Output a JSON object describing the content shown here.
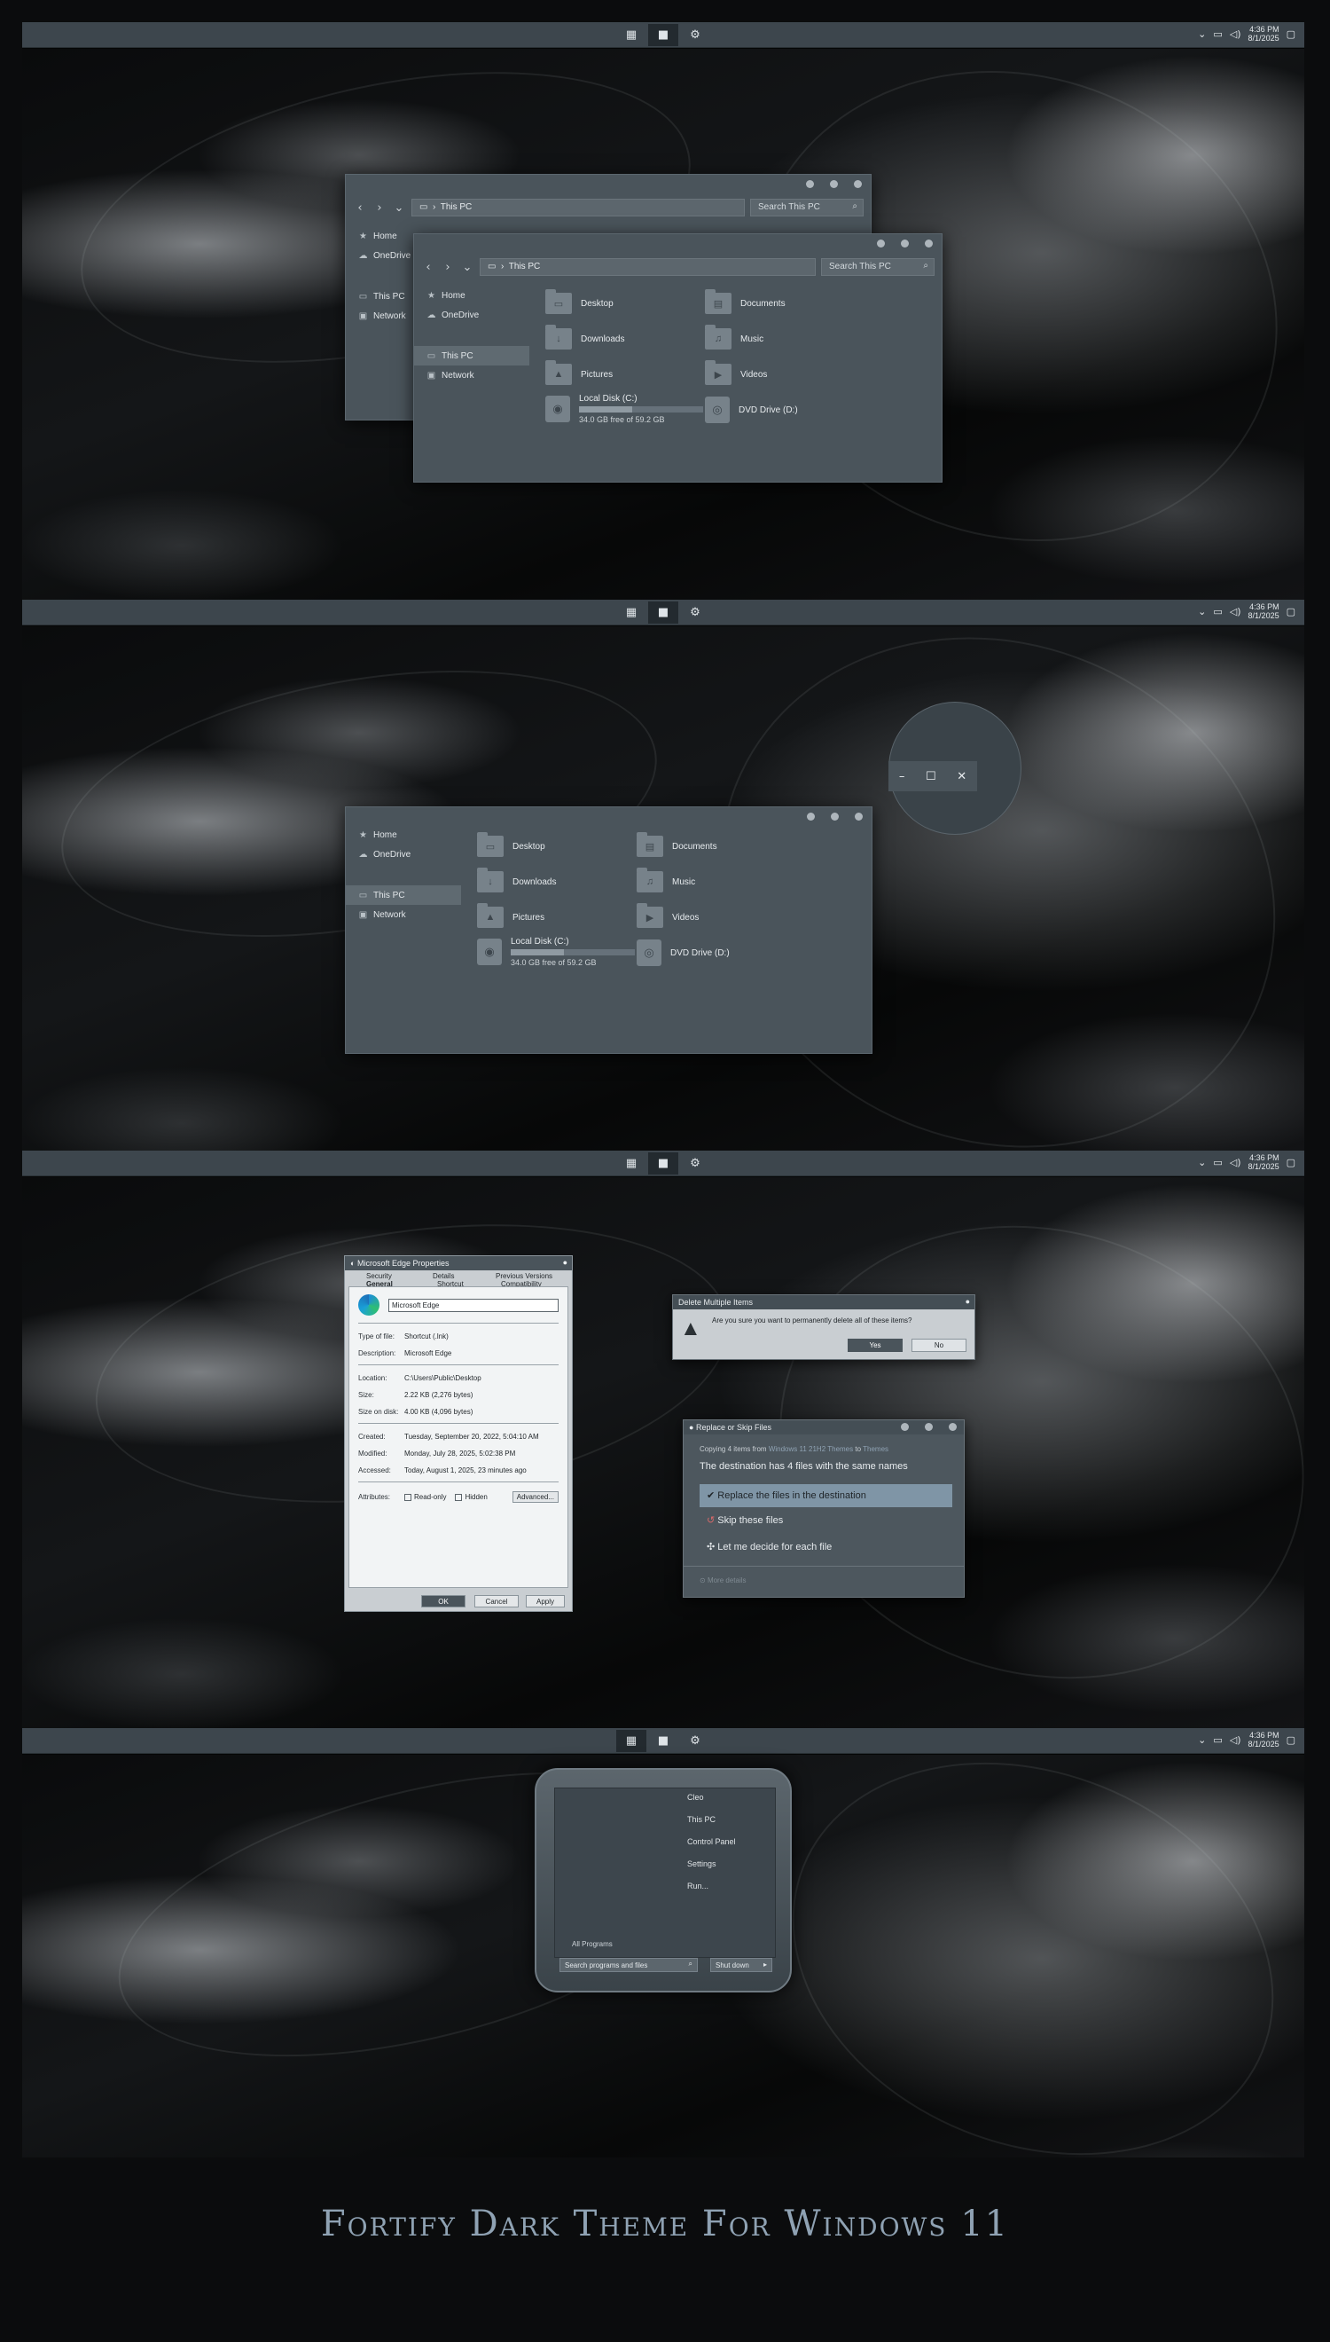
{
  "colors": {
    "taskbar": "#3d464d",
    "window": "#4a545b",
    "accent": "#8fa2b3",
    "selection": "#7f95a6"
  },
  "taskbar": {
    "time": "4:36 PM",
    "date": "8/1/2025",
    "icons": [
      "start-grid-icon",
      "file-explorer-icon",
      "settings-icon"
    ]
  },
  "explorer": {
    "address": "This PC",
    "search_placeholder": "Search This PC",
    "nav": [
      "Home",
      "OneDrive",
      "This PC",
      "Network"
    ],
    "folders": [
      "Desktop",
      "Documents",
      "Downloads",
      "Music",
      "Pictures",
      "Videos"
    ],
    "drive_c": {
      "label": "Local Disk (C:)",
      "space": "34.0 GB free of 59.2 GB",
      "used_fraction": 0.43
    },
    "drive_d": {
      "label": "DVD Drive (D:)"
    }
  },
  "properties": {
    "title": "Microsoft Edge Properties",
    "tabs": [
      "Security",
      "Details",
      "Previous Versions",
      "General",
      "Shortcut",
      "Compatibility"
    ],
    "name": "Microsoft Edge",
    "type_label": "Type of file:",
    "type": "Shortcut (.lnk)",
    "desc_label": "Description:",
    "desc": "Microsoft Edge",
    "loc_label": "Location:",
    "location": "C:\\Users\\Public\\Desktop",
    "size_label": "Size:",
    "size": "2.22 KB (2,276 bytes)",
    "disk_label": "Size on disk:",
    "disk": "4.00 KB (4,096 bytes)",
    "created_label": "Created:",
    "created": "Tuesday, September 20, 2022, 5:04:10 AM",
    "modified_label": "Modified:",
    "modified": "Monday, July 28, 2025, 5:02:38 PM",
    "accessed_label": "Accessed:",
    "accessed": "Today, August 1, 2025, 23 minutes ago",
    "attr_label": "Attributes:",
    "readonly": "Read-only",
    "hidden": "Hidden",
    "advanced": "Advanced...",
    "ok": "OK",
    "cancel": "Cancel",
    "apply": "Apply"
  },
  "delete_dialog": {
    "title": "Delete Multiple Items",
    "message": "Are you sure you want to permanently delete all of these items?",
    "yes": "Yes",
    "no": "No"
  },
  "replace_dialog": {
    "title": "Replace or Skip Files",
    "copying_prefix": "Copying 4 items from",
    "source": "Windows 11 21H2 Themes",
    "to": "to",
    "dest": "Themes",
    "heading": "The destination has 4 files with the same names",
    "opt1": "Replace the files in the destination",
    "opt2": "Skip these files",
    "opt3": "Let me decide for each file",
    "details": "More details"
  },
  "start_menu": {
    "items": [
      "Cleo",
      "This PC",
      "Control Panel",
      "Settings",
      "Run..."
    ],
    "all_programs": "All Programs",
    "search": "Search programs and files",
    "shutdown": "Shut down"
  },
  "caption": "Fortify Dark Theme For Windows 11"
}
